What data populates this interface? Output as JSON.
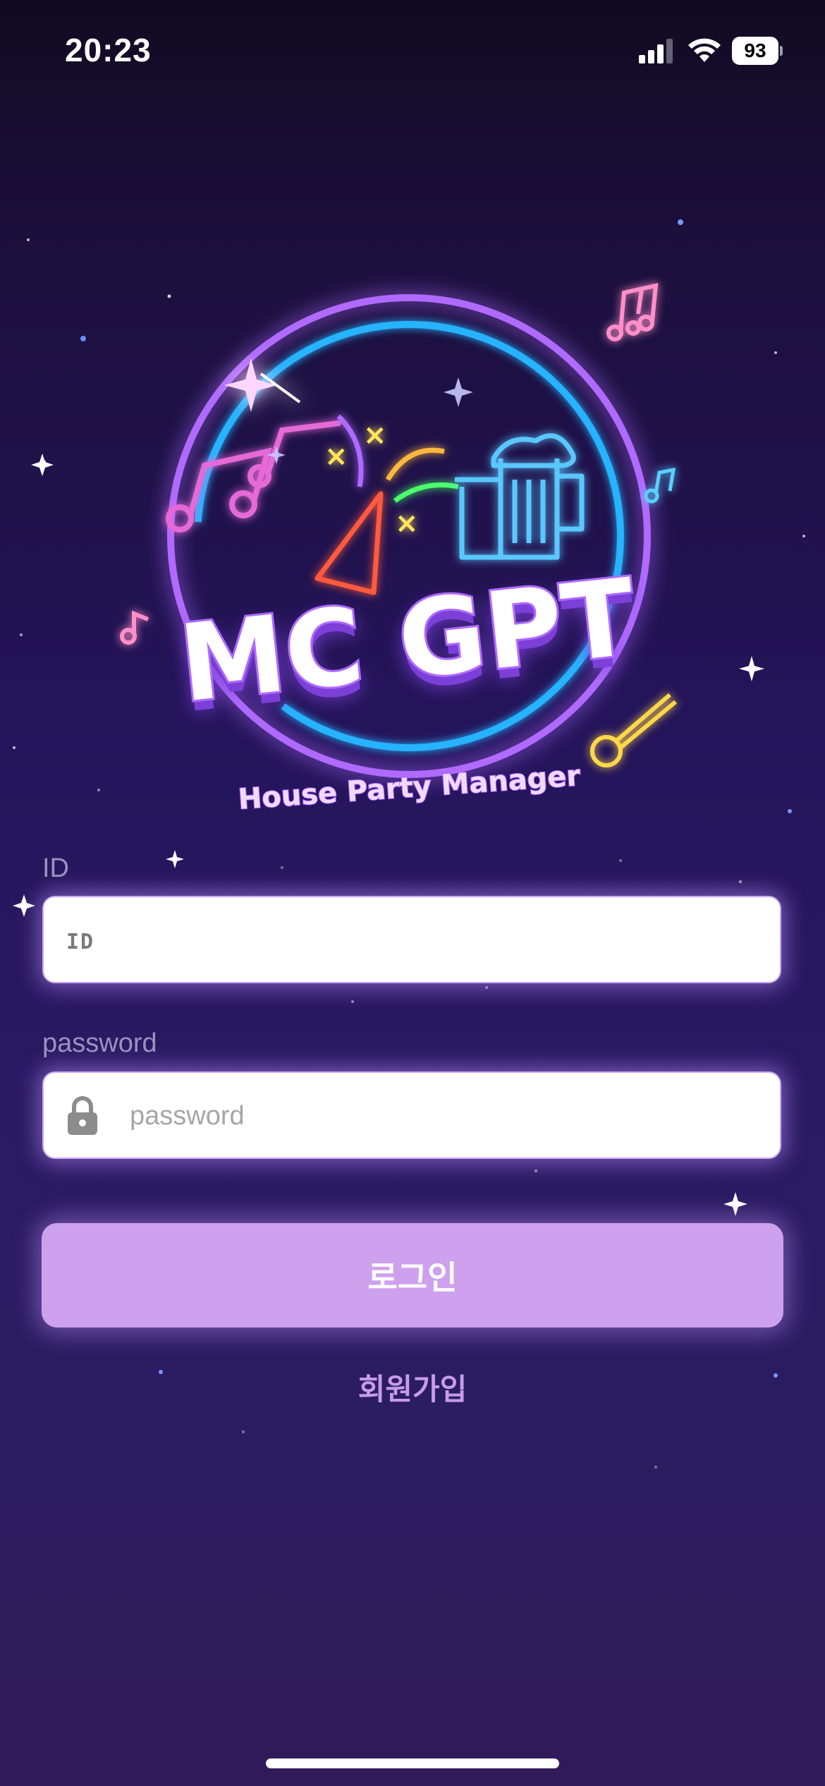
{
  "status_bar": {
    "time": "20:23",
    "battery": "93",
    "icons": [
      "signal-icon",
      "wifi-icon",
      "battery-icon"
    ]
  },
  "logo": {
    "title": "MC GPT",
    "subtitle": "House Party Manager",
    "icons": [
      "music-notes-icon",
      "party-popper-icon",
      "beer-mugs-icon",
      "microphone-icon"
    ]
  },
  "form": {
    "id_label": "ID",
    "id_placeholder": "ID",
    "password_label": "password",
    "password_placeholder": "password",
    "login_button": "로그인",
    "signup_link": "회원가입"
  },
  "colors": {
    "accent": "#cea1ee",
    "link": "#c79be8",
    "background_top": "#120a22",
    "background_mid": "#2a1a63"
  }
}
